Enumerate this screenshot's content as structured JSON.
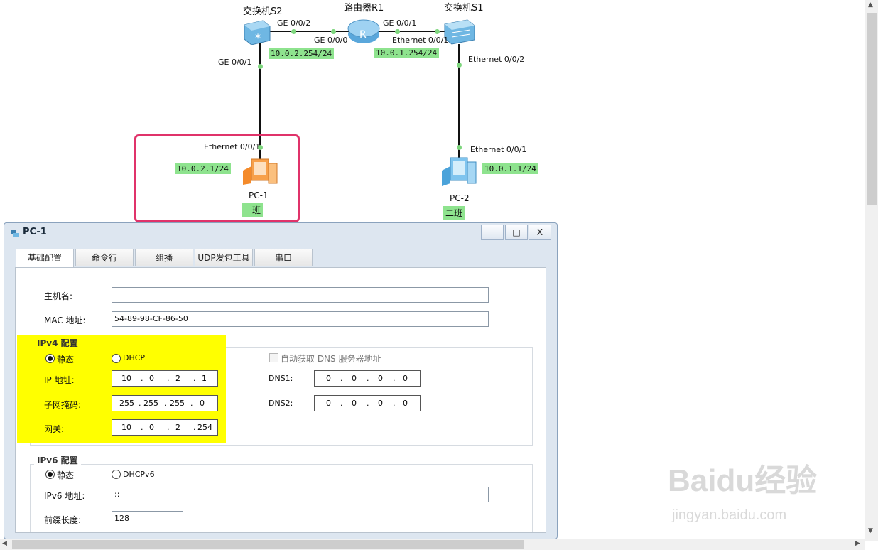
{
  "topology": {
    "switch_s2": "交换机S2",
    "router_r1": "路由器R1",
    "switch_s1": "交换机S1",
    "ports": {
      "s2_ge002": "GE 0/0/2",
      "r1_ge001": "GE 0/0/1",
      "r1_ge000": "GE 0/0/0",
      "s1_eth001": "Ethernet 0/0/1",
      "s2_ge001": "GE 0/0/1",
      "s1_eth002": "Ethernet 0/0/2",
      "pc1_eth001": "Ethernet 0/0/1",
      "pc2_eth001": "Ethernet 0/0/1"
    },
    "ips": {
      "r1_to_s2": "10.0.2.254/24",
      "r1_to_s1": "10.0.1.254/24",
      "pc1": "10.0.2.1/24",
      "pc2": "10.0.1.1/24"
    },
    "pc1_name": "PC-1",
    "pc2_name": "PC-2",
    "pc1_tag": "一班",
    "pc2_tag": "二班"
  },
  "window": {
    "title": "PC-1",
    "minimize": "_",
    "maximize": "□",
    "close": "X",
    "tabs": [
      "基础配置",
      "命令行",
      "组播",
      "UDP发包工具",
      "串口"
    ],
    "active_tab": "基础配置"
  },
  "form": {
    "hostname_label": "主机名:",
    "hostname_value": "",
    "mac_label": "MAC 地址:",
    "mac_value": "54-89-98-CF-86-50",
    "ipv4": {
      "title": "IPv4 配置",
      "static_label": "静态",
      "dhcp_label": "DHCP",
      "auto_dns_label": "自动获取 DNS 服务器地址",
      "ip_label": "IP 地址:",
      "ip": [
        "10",
        "0",
        "2",
        "1"
      ],
      "mask_label": "子网掩码:",
      "mask": [
        "255",
        "255",
        "255",
        "0"
      ],
      "gateway_label": "网关:",
      "gateway": [
        "10",
        "0",
        "2",
        "254"
      ],
      "dns1_label": "DNS1:",
      "dns1": [
        "0",
        "0",
        "0",
        "0"
      ],
      "dns2_label": "DNS2:",
      "dns2": [
        "0",
        "0",
        "0",
        "0"
      ]
    },
    "ipv6": {
      "title": "IPv6 配置",
      "static_label": "静态",
      "dhcp_label": "DHCPv6",
      "ip_label": "IPv6 地址:",
      "ip_value": "::",
      "prefix_label": "前缀长度:",
      "prefix_value": "128"
    }
  },
  "watermark": {
    "brand": "Baidu经验",
    "url": "jingyan.baidu.com"
  },
  "colors": {
    "highlight_border": "#e0336a",
    "ip_label_bg": "#8ee38e",
    "annotation_yellow": "#ffff00"
  }
}
